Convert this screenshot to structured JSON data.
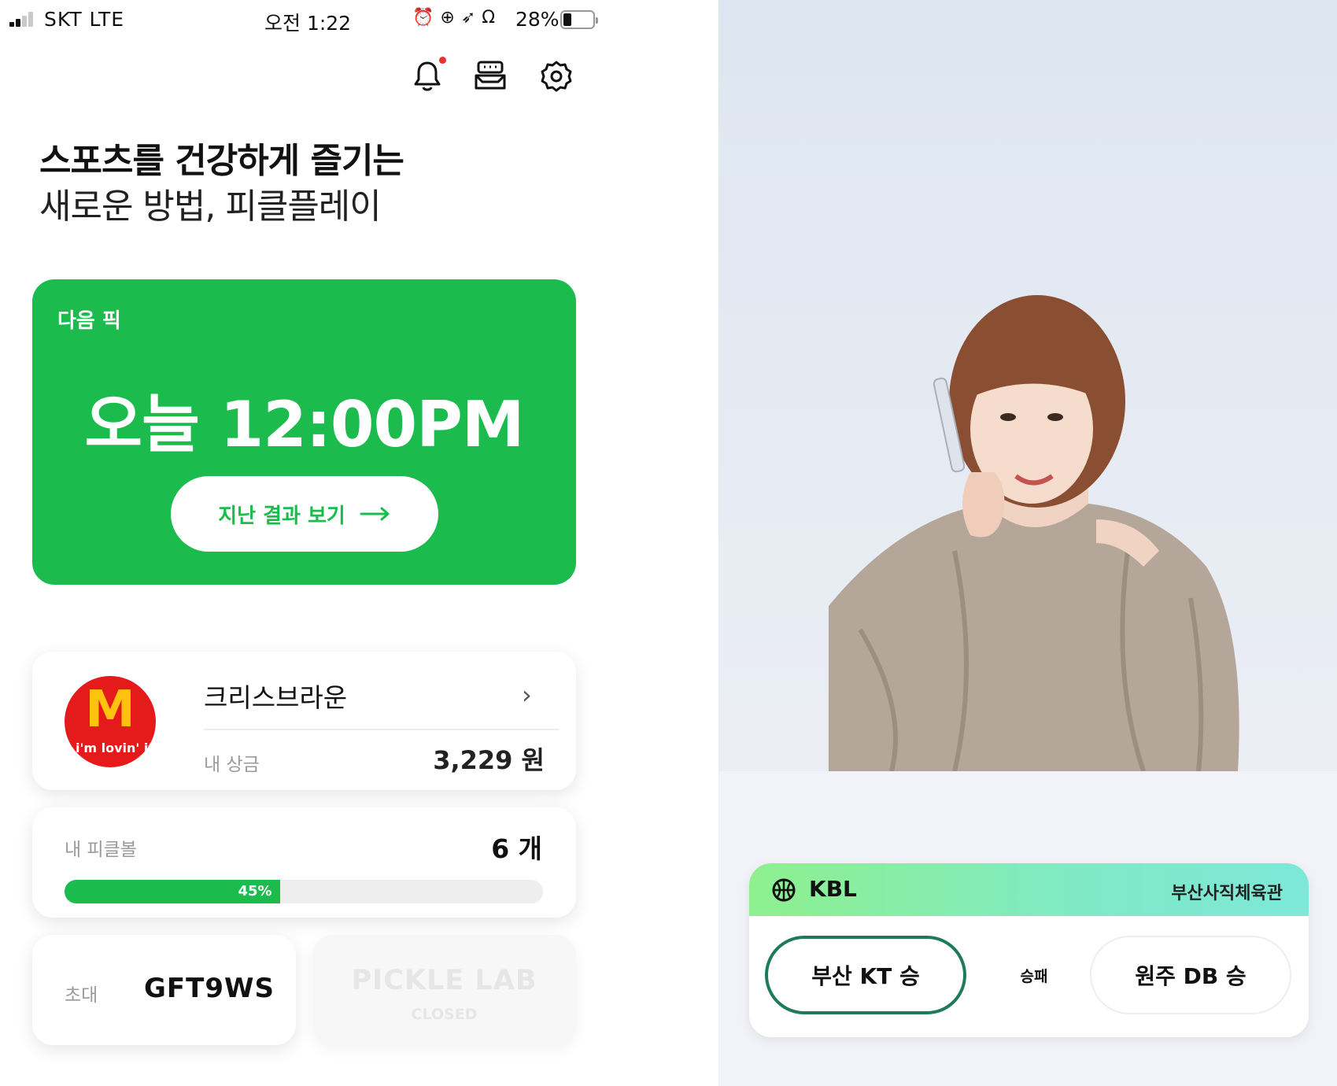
{
  "statusbar": {
    "carrier": "SKT LTE",
    "time": "오전 1:22",
    "battery_pct": "28%",
    "battery_level": 0.28,
    "icons": [
      "alarm-icon",
      "rotation-lock-icon",
      "location-icon",
      "headphones-icon"
    ]
  },
  "header": {
    "icons": [
      "bell-icon",
      "inbox-icon",
      "gear-icon"
    ],
    "notification_dot": true
  },
  "headline": {
    "line1": "스포츠를 건강하게 즐기는",
    "line2": "새로운 방법, 피클플레이"
  },
  "next_pick": {
    "label": "다음 픽",
    "time": "오늘 12:00PM",
    "button_label": "지난 결과 보기",
    "button_icon": "arrow-right-icon",
    "accent": "#1bbb4e"
  },
  "prize": {
    "name": "크리스브라운",
    "label": "내 상금",
    "value": "3,229 원",
    "logo_slogan": "i'm lovin' it"
  },
  "balls": {
    "label": "내 피클볼",
    "value": "6 개",
    "progress_text": "45%",
    "progress": 0.45
  },
  "invite": {
    "label": "초대",
    "code": "GFT9WS"
  },
  "lab": {
    "title": "PICKLE LAB",
    "status": "CLOSED"
  },
  "video": {
    "kbl": {
      "league": "KBL",
      "venue": "부산사직체육관",
      "home_option": "부산 KT 승",
      "draw_option": "승패",
      "away_option": "원주 DB 승",
      "selected": "home",
      "selected_color": "#1d7b5a"
    }
  }
}
